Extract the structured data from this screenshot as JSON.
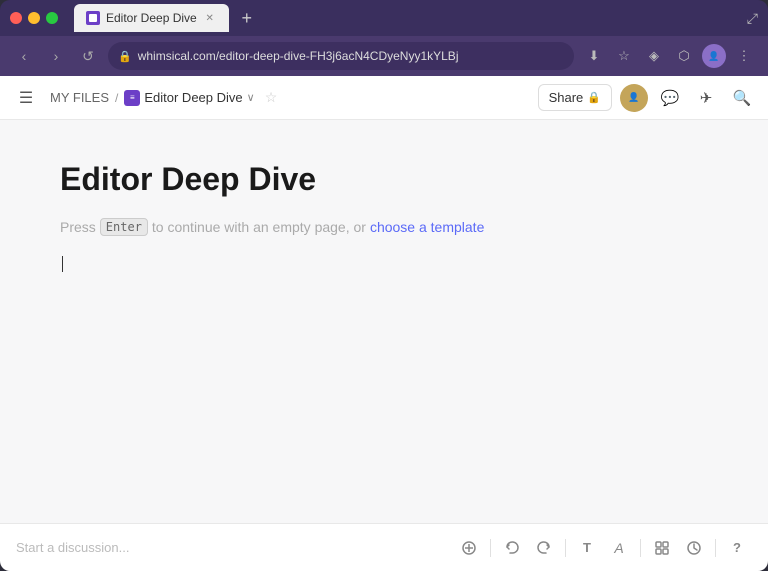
{
  "browser": {
    "tab": {
      "title": "Editor Deep Dive",
      "favicon_label": "whimsical-favicon"
    },
    "new_tab_label": "+",
    "address": "whimsical.com/editor-deep-dive-FH3j6acN4CDyeNyy1kYLBj",
    "nav": {
      "back": "‹",
      "forward": "›",
      "refresh": "↺"
    },
    "actions": {
      "download": "⬇",
      "bookmark": "☆",
      "extensions": "⬡",
      "profile": "U",
      "menu": "⋮"
    }
  },
  "toolbar": {
    "menu_label": "☰",
    "breadcrumb": {
      "files_label": "MY FILES",
      "separator": "/",
      "doc_label": "Editor Deep Dive"
    },
    "chevron": "∨",
    "star": "☆",
    "share_label": "Share",
    "lock_icon": "🔒",
    "chat_icon": "💬",
    "send_icon": "✈",
    "search_icon": "🔍"
  },
  "editor": {
    "title": "Editor Deep Dive",
    "placeholder": {
      "press_text": "Press",
      "enter_key": "Enter",
      "continue_text": "to continue with an empty page, or",
      "template_link": "choose a template"
    }
  },
  "bottom_bar": {
    "discussion_placeholder": "Start a discussion...",
    "actions": {
      "attach": "⊘",
      "undo": "↩",
      "redo": "↪",
      "text_format": "T",
      "font": "A",
      "layout": "⊞",
      "history": "⟳",
      "help": "?"
    }
  },
  "colors": {
    "brand_purple": "#6c3fc7",
    "link_blue": "#5b6af7",
    "bg_gray": "#f7f7f8"
  }
}
